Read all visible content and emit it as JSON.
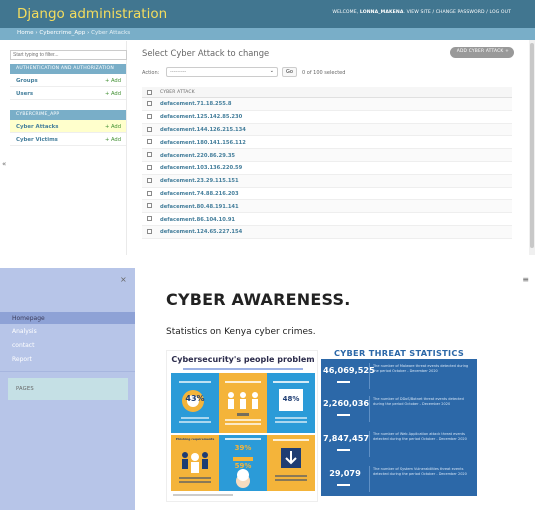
{
  "admin": {
    "brand": "Django administration",
    "user_tools": {
      "welcome": "WELCOME,",
      "username": "LONNA_MAKENA",
      "view_site": "VIEW SITE",
      "change_password": "CHANGE PASSWORD",
      "logout": "LOG OUT",
      "sep": "/"
    },
    "breadcrumbs": {
      "home": "Home",
      "app": "Cybercrime_App",
      "current": "Cyber Attacks",
      "sep": "›"
    },
    "sidebar": {
      "filter_placeholder": "Start typing to filter...",
      "modules": [
        {
          "caption": "AUTHENTICATION AND AUTHORIZATION",
          "models": [
            {
              "name": "Groups",
              "add": "+ Add"
            },
            {
              "name": "Users",
              "add": "+ Add"
            }
          ]
        },
        {
          "caption": "CYBERCRIME_APP",
          "models": [
            {
              "name": "Cyber Attacks",
              "add": "+ Add"
            },
            {
              "name": "Cyber Victims",
              "add": "+ Add"
            }
          ]
        }
      ],
      "collapse_glyph": "«"
    },
    "main": {
      "title": "Select Cyber Attack to change",
      "add_button": "ADD CYBER ATTACK",
      "add_icon": "+",
      "action_label": "Action:",
      "action_value": "---------",
      "go_label": "Go",
      "selection_counter": "0 of 100 selected",
      "column_header": "CYBER ATTACK",
      "rows": [
        "defacement.71.18.255.8",
        "defacement.125.142.85.230",
        "defacement.144.126.215.134",
        "defacement.180.141.156.112",
        "defacement.220.86.29.35",
        "defacement.103.136.220.59",
        "defacement.23.29.115.151",
        "defacement.74.88.216.203",
        "defacement.80.48.191.141",
        "defacement.86.104.10.91",
        "defacement.124.65.227.154"
      ]
    }
  },
  "awareness": {
    "nav": {
      "close_glyph": "×",
      "items": [
        "Homepage",
        "Analysis",
        "contact",
        "Report"
      ],
      "pages_label": "PAGES",
      "menu_glyph": "≡"
    },
    "heading": "CYBER AWARENESS.",
    "subheading": "Statistics on Kenya cyber crimes.",
    "poster": {
      "title": "Cybersecurity's people problem",
      "cells": [
        {
          "label": "",
          "big": "43%",
          "color": "#2b9bd8"
        },
        {
          "label": "",
          "big": "",
          "color": "#f4b43a"
        },
        {
          "label": "",
          "big": "48%",
          "color": "#2b9bd8"
        },
        {
          "label": "Phishing requirements",
          "big": "",
          "color": "#f4b43a"
        },
        {
          "label": "",
          "big": "39%",
          "color": "#2b9bd8"
        },
        {
          "label": "",
          "big": "",
          "color": "#f4b43a"
        }
      ],
      "extra_big": "59%"
    },
    "stats": {
      "title": "CYBER THREAT STATISTICS",
      "rows": [
        {
          "number": "46,069,525",
          "desc": "The number of Malware threat events detected during the period October - December 2020"
        },
        {
          "number": "2,260,036",
          "desc": "The number of DDoS/Botnet threat events detected during the period October - December 2020"
        },
        {
          "number": "7,847,457",
          "desc": "The number of Web Application attack threat events detected during the period October - December 2020"
        },
        {
          "number": "29,079",
          "desc": "The number of System Vulnerabilities threat events detected during the period October - December 2020"
        }
      ]
    }
  },
  "colors": {
    "django_header": "#417690",
    "django_brand": "#f5dd5d",
    "django_breadcrumb": "#79aec8",
    "django_link": "#447e9b",
    "add_green": "#3f8f30",
    "nav_bg": "#b7c5e8",
    "stats_bg": "#2c68a8"
  }
}
